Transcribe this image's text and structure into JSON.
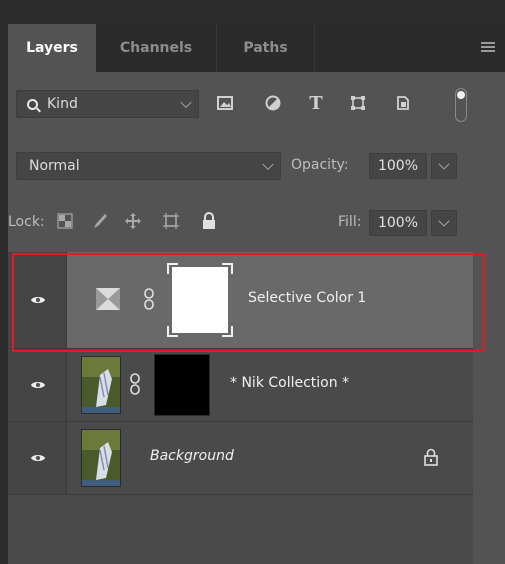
{
  "tabs": [
    {
      "label": "Layers",
      "active": true
    },
    {
      "label": "Channels",
      "active": false
    },
    {
      "label": "Paths",
      "active": false
    }
  ],
  "filter": {
    "kind_label": "Kind",
    "icons": [
      "image-filter-icon",
      "adjustment-filter-icon",
      "type-filter-icon",
      "shape-filter-icon",
      "smart-object-filter-icon"
    ],
    "type_glyph": "T"
  },
  "blend": {
    "mode": "Normal",
    "opacity_label": "Opacity:",
    "opacity_value": "100%"
  },
  "lock": {
    "label": "Lock:",
    "fill_label": "Fill:",
    "fill_value": "100%"
  },
  "layers": [
    {
      "name": "Selective Color 1",
      "type": "adjustment",
      "visible": true,
      "selected": true
    },
    {
      "name": "* Nik Collection *",
      "type": "smart-object-with-mask",
      "visible": true,
      "selected": false
    },
    {
      "name": "Background",
      "type": "background",
      "visible": true,
      "selected": false,
      "locked": true
    }
  ],
  "colors": {
    "panel_bg": "#535353",
    "tab_bg": "#2b2b2b",
    "selected_row": "#696969",
    "highlight_border": "#e01b22"
  }
}
